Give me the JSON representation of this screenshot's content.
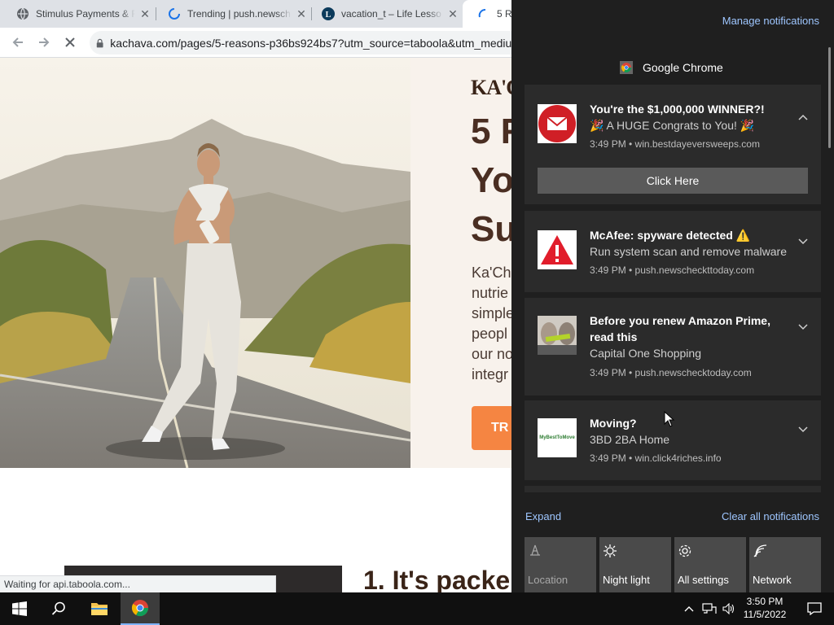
{
  "browser": {
    "tabs": [
      {
        "title": "Stimulus Payments & F",
        "state": "inactive"
      },
      {
        "title": "Trending | push.newsch",
        "state": "loading"
      },
      {
        "title": "vacation_t – Life Lesso",
        "state": "inactive"
      },
      {
        "title": "5 Re",
        "state": "active-loading"
      }
    ],
    "url": "kachava.com/pages/5-reasons-p36bs924bs7?utm_source=taboola&utm_medium",
    "status_text": "Waiting for api.taboola.com..."
  },
  "page": {
    "brand": "KA'CH",
    "headline_lines": [
      "5 R",
      "You",
      "Su"
    ],
    "body_lines": [
      "Ka'Ch",
      "nutrie",
      "simple",
      "peopl",
      "our no",
      "integr"
    ],
    "cta_label": "TR",
    "section_heading": "1. It's packe"
  },
  "action_center": {
    "manage_label": "Manage notifications",
    "app_name": "Google Chrome",
    "notifications": [
      {
        "title": "You're the $1,000,000 WINNER?!",
        "body": "🎉 A HUGE Congrats to You! 🎉",
        "meta": "3:49 PM • win.bestdayeversweeps.com",
        "action": "Click Here",
        "icon": "envelope-icon"
      },
      {
        "title": "McAfee: spyware detected ⚠️",
        "body": "Run system scan and remove malware",
        "meta": "3:49 PM • push.newscheckttoday.com",
        "icon": "warning-icon"
      },
      {
        "title_line1": "Before you renew Amazon Prime,",
        "title_line2": "read this",
        "body": "Capital One Shopping",
        "meta": "3:49 PM • push.newschecktoday.com",
        "icon": "faces-thumbnail"
      },
      {
        "title": "Moving?",
        "body": "3BD 2BA Home",
        "meta": "3:49 PM • win.click4riches.info",
        "icon": "mybesttomove-logo",
        "logo_text": "MyBestToMove"
      }
    ],
    "expand_label": "Expand",
    "clear_label": "Clear all notifications",
    "quick_actions": [
      {
        "label": "Location",
        "enabled": false,
        "icon": "location-icon"
      },
      {
        "label": "Night light",
        "enabled": true,
        "icon": "brightness-icon"
      },
      {
        "label": "All settings",
        "enabled": true,
        "icon": "gear-icon"
      },
      {
        "label": "Network",
        "enabled": true,
        "icon": "network-icon"
      }
    ]
  },
  "taskbar": {
    "time": "3:50 PM",
    "date": "11/5/2022"
  },
  "colors": {
    "action_center_bg": "#1f1f1f",
    "notification_bg": "#2b2b2b",
    "link": "#9ec6ff",
    "cta_orange": "#f58542",
    "brand_brown": "#4a2e22"
  }
}
